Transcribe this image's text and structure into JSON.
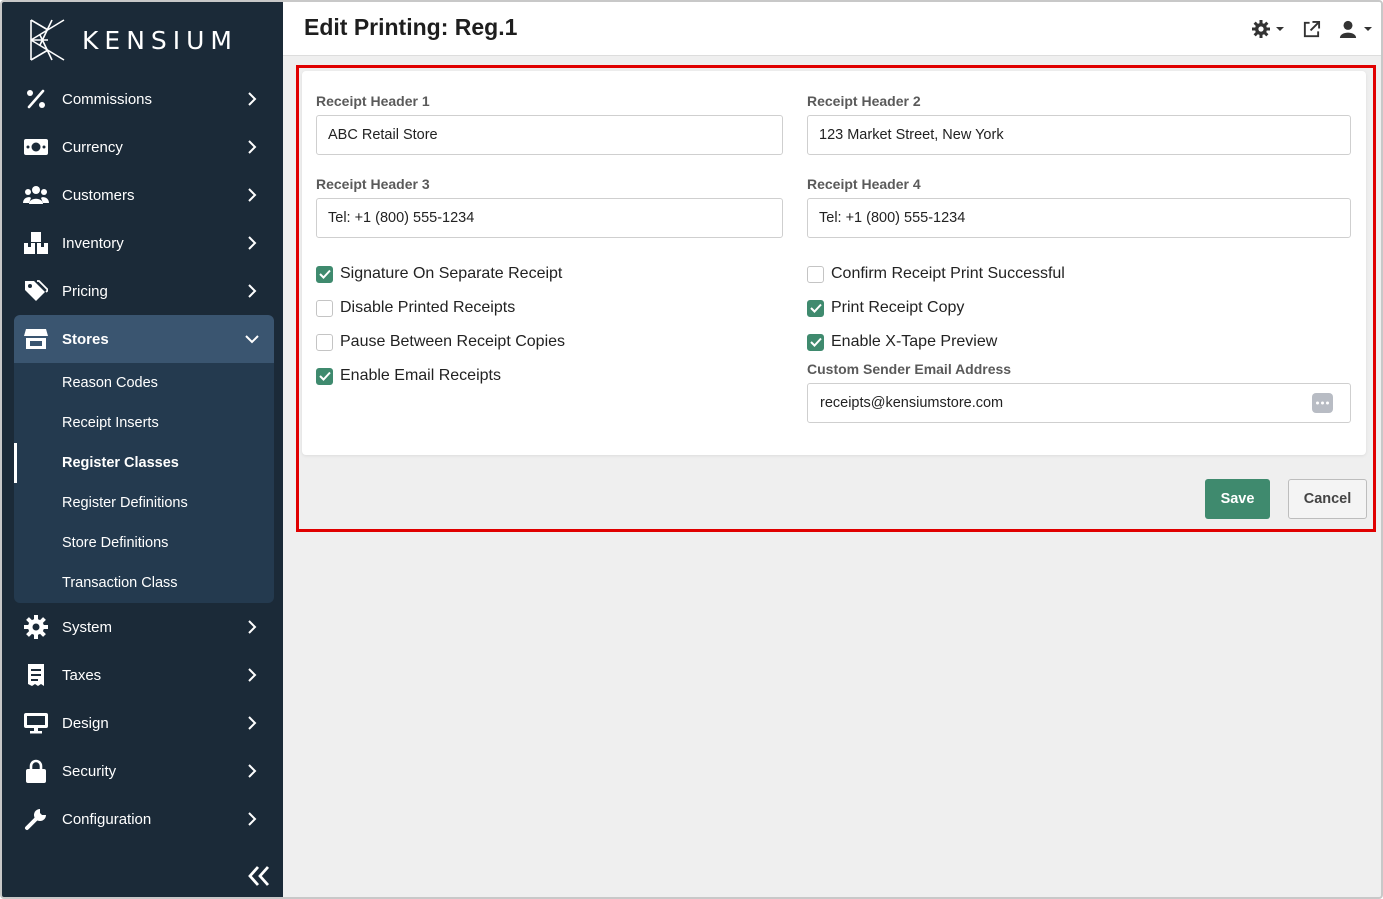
{
  "app": {
    "brand": "KENSIUM",
    "page_title": "Edit Printing: Reg.1"
  },
  "sidebar": {
    "items": [
      {
        "label": "Commissions",
        "icon": "percent-icon"
      },
      {
        "label": "Currency",
        "icon": "money-bill-icon"
      },
      {
        "label": "Customers",
        "icon": "users-icon"
      },
      {
        "label": "Inventory",
        "icon": "boxes-icon"
      },
      {
        "label": "Pricing",
        "icon": "tags-icon"
      },
      {
        "label": "Stores",
        "icon": "store-icon",
        "expanded": true
      },
      {
        "label": "System",
        "icon": "gear-icon"
      },
      {
        "label": "Taxes",
        "icon": "receipt-icon"
      },
      {
        "label": "Design",
        "icon": "monitor-icon"
      },
      {
        "label": "Security",
        "icon": "lock-icon"
      },
      {
        "label": "Configuration",
        "icon": "wrench-icon"
      }
    ],
    "stores_sub": [
      {
        "label": "Reason Codes"
      },
      {
        "label": "Receipt Inserts"
      },
      {
        "label": "Register Classes",
        "current": true
      },
      {
        "label": "Register Definitions"
      },
      {
        "label": "Store Definitions"
      },
      {
        "label": "Transaction Class"
      }
    ]
  },
  "form": {
    "header1": {
      "label": "Receipt Header 1",
      "value": "ABC Retail Store"
    },
    "header2": {
      "label": "Receipt Header 2",
      "value": "123 Market Street, New York"
    },
    "header3": {
      "label": "Receipt Header 3",
      "value": "Tel: +1 (800) 555-1234"
    },
    "header4": {
      "label": "Receipt Header 4",
      "value": "Tel: +1 (800) 555-1234"
    },
    "checks_left": [
      {
        "label": "Signature On Separate Receipt",
        "checked": true
      },
      {
        "label": "Disable Printed Receipts",
        "checked": false
      },
      {
        "label": "Pause Between Receipt Copies",
        "checked": false
      },
      {
        "label": "Enable Email Receipts",
        "checked": true
      }
    ],
    "checks_right": [
      {
        "label": "Confirm Receipt Print Successful",
        "checked": false
      },
      {
        "label": "Print Receipt Copy",
        "checked": true
      },
      {
        "label": "Enable X-Tape Preview",
        "checked": true
      }
    ],
    "email": {
      "label": "Custom Sender Email Address",
      "value": "receipts@kensiumstore.com"
    }
  },
  "actions": {
    "save_label": "Save",
    "cancel_label": "Cancel"
  },
  "colors": {
    "sidebar_bg": "#1b2a38",
    "accent_green": "#3f8a6e",
    "highlight_red": "#e00000"
  }
}
